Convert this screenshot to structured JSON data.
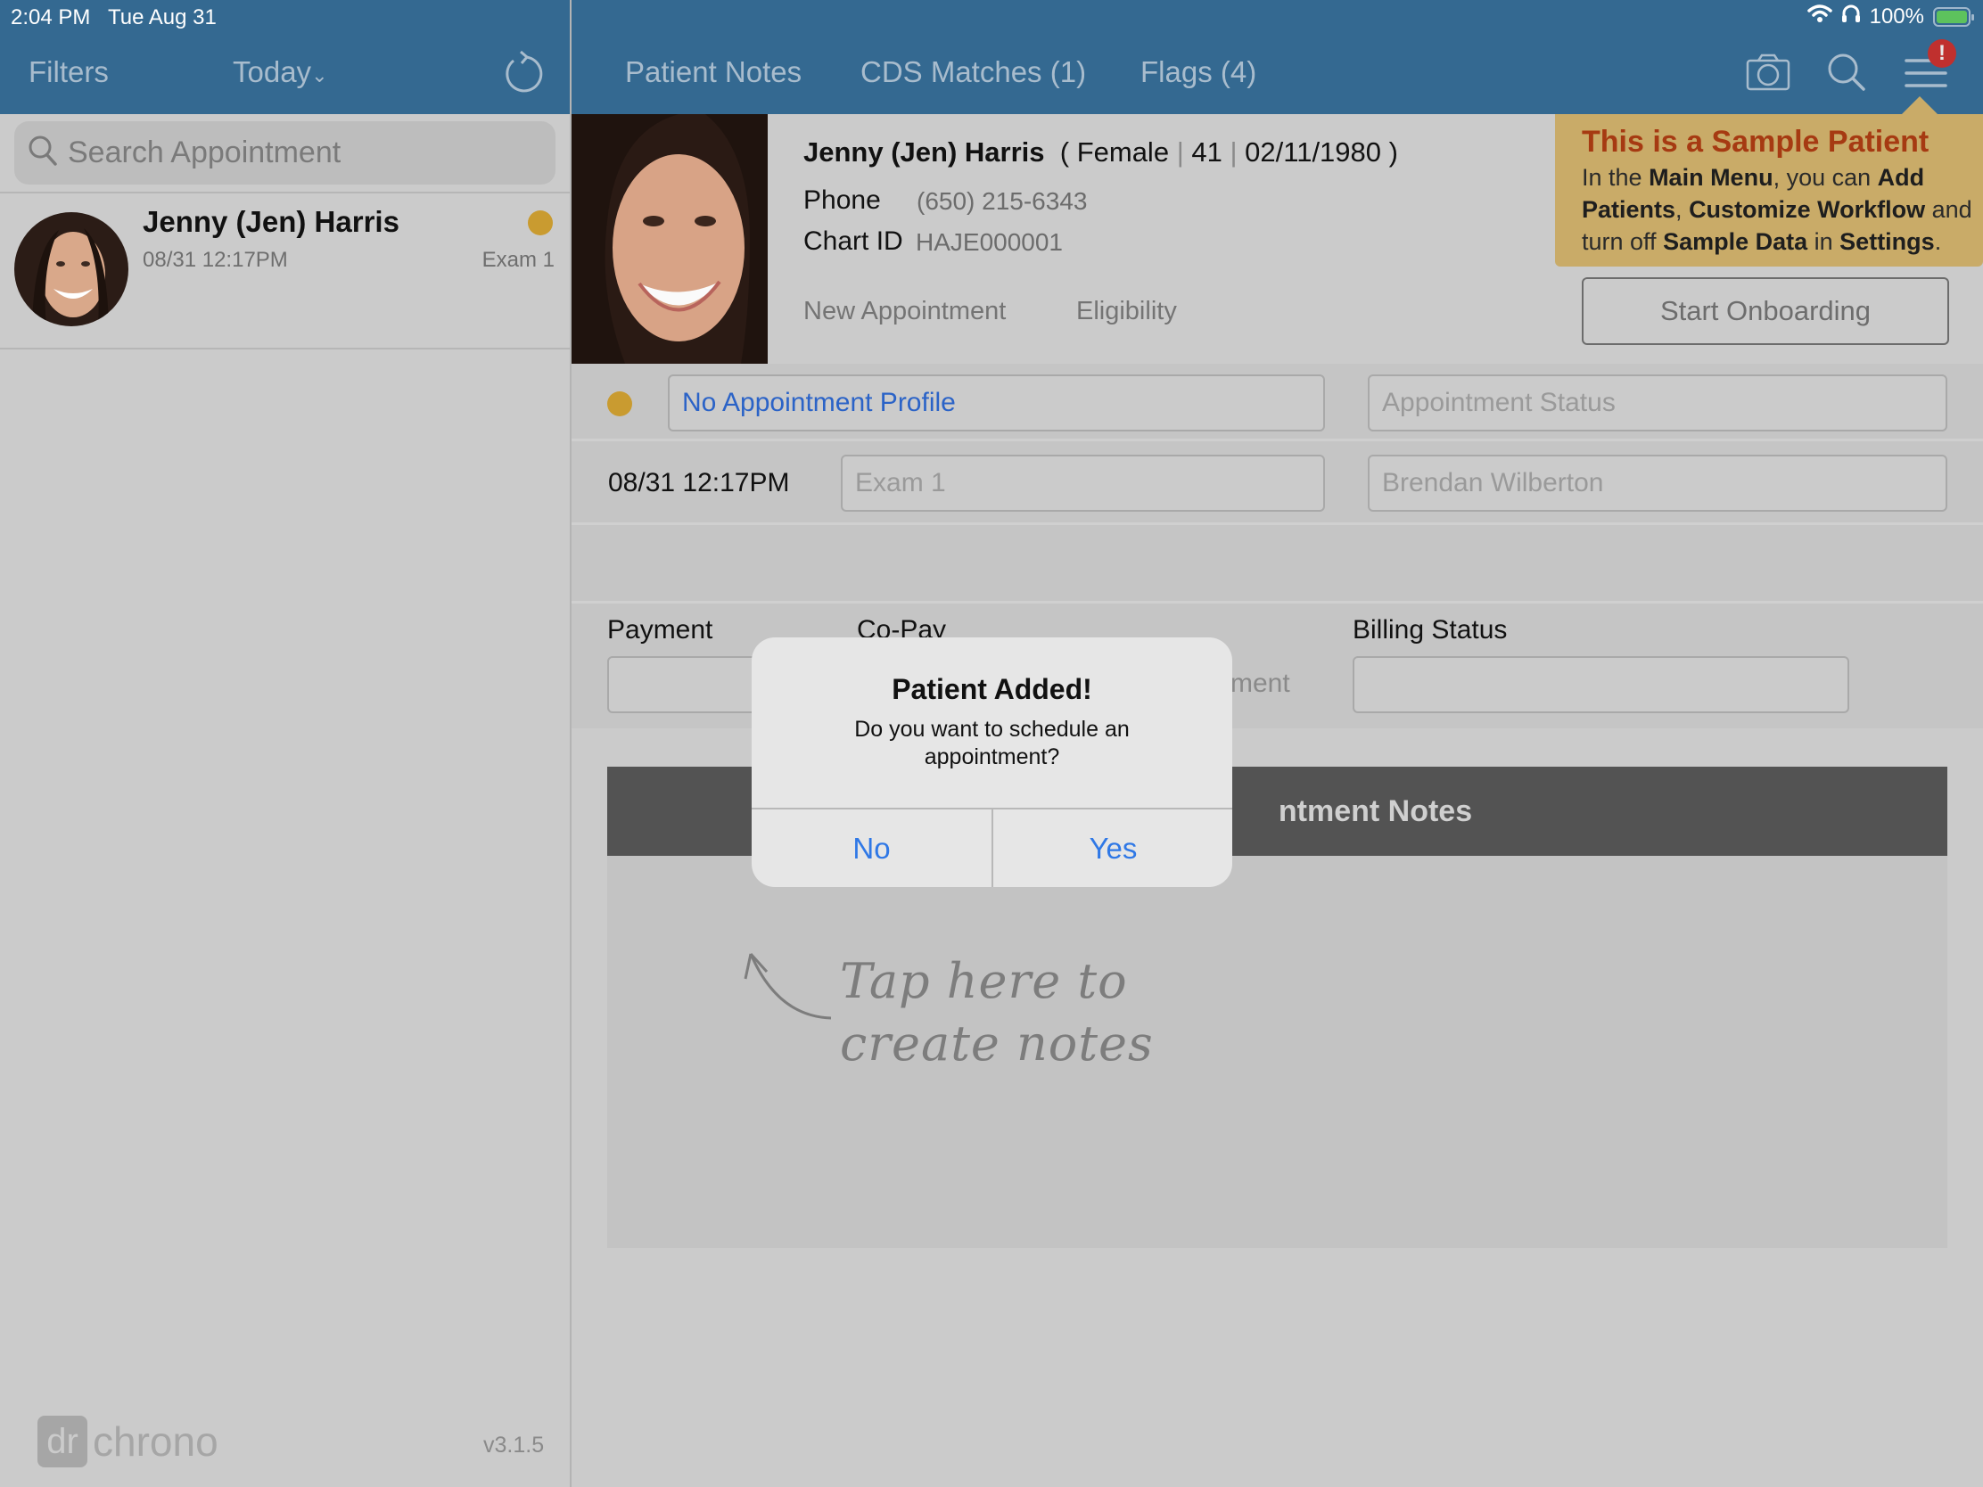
{
  "status_bar": {
    "time": "2:04 PM",
    "date": "Tue Aug 31",
    "battery": "100%",
    "icons": [
      "wifi-icon",
      "headphones-icon",
      "battery-charging-icon"
    ]
  },
  "left_nav": {
    "filters_label": "Filters",
    "date_filter_label": "Today",
    "date_filter_chevron": "⌄",
    "refresh_icon": "refresh-icon"
  },
  "tabs": [
    {
      "label": "Patient Notes"
    },
    {
      "label": "CDS Matches (1)"
    },
    {
      "label": "Flags (4)"
    }
  ],
  "toolbar_icons": {
    "camera": "camera-icon",
    "search": "search-icon",
    "menu": "menu-icon",
    "alert_badge": "!"
  },
  "search": {
    "placeholder": "Search Appointment"
  },
  "appointment_list": [
    {
      "name": "Jenny (Jen) Harris",
      "time": "08/31 12:17PM",
      "room": "Exam 1",
      "status_color": "#c99b30"
    }
  ],
  "footer": {
    "logo_box": "dr",
    "logo_text": "chrono",
    "version": "v3.1.5"
  },
  "patient": {
    "name": "Jenny (Jen) Harris",
    "open_paren": "(",
    "gender": "Female",
    "age": "41",
    "dob": "02/11/1980",
    "close_paren": ")",
    "separator": "|",
    "phone_label": "Phone",
    "phone": "(650) 215-6343",
    "chart_id_label": "Chart ID",
    "chart_id": "HAJE000001",
    "new_appointment_label": "New Appointment",
    "eligibility_label": "Eligibility"
  },
  "sample_tooltip": {
    "title": "This is a Sample Patient",
    "t1": "In the ",
    "b1": "Main Menu",
    "t2": ", you can ",
    "b2": "Add Patients",
    "t3": ", ",
    "b3": "Customize Workflow",
    "t4": " and turn off ",
    "b4": "Sample Data",
    "t5": " in ",
    "b5": "Settings",
    "t6": "."
  },
  "onboarding_button": "Start Onboarding",
  "appointment": {
    "status_color": "#c99b30",
    "profile": "No Appointment Profile",
    "status_placeholder": "Appointment Status",
    "time": "08/31 12:17PM",
    "room": "Exam 1",
    "provider": "Brendan Wilberton"
  },
  "billing": {
    "payment_label": "Payment",
    "copay_label": "Co-Pay",
    "copay_partial_text": "ment",
    "billing_status_label": "Billing Status",
    "payment_value": "",
    "billing_status_value": ""
  },
  "notes": {
    "header_visible": "ntment Notes",
    "hint_line1": "Tap here to",
    "hint_line2": "create notes"
  },
  "dialog": {
    "title": "Patient Added!",
    "message": "Do you want to schedule an appointment?",
    "no_label": "No",
    "yes_label": "Yes"
  }
}
